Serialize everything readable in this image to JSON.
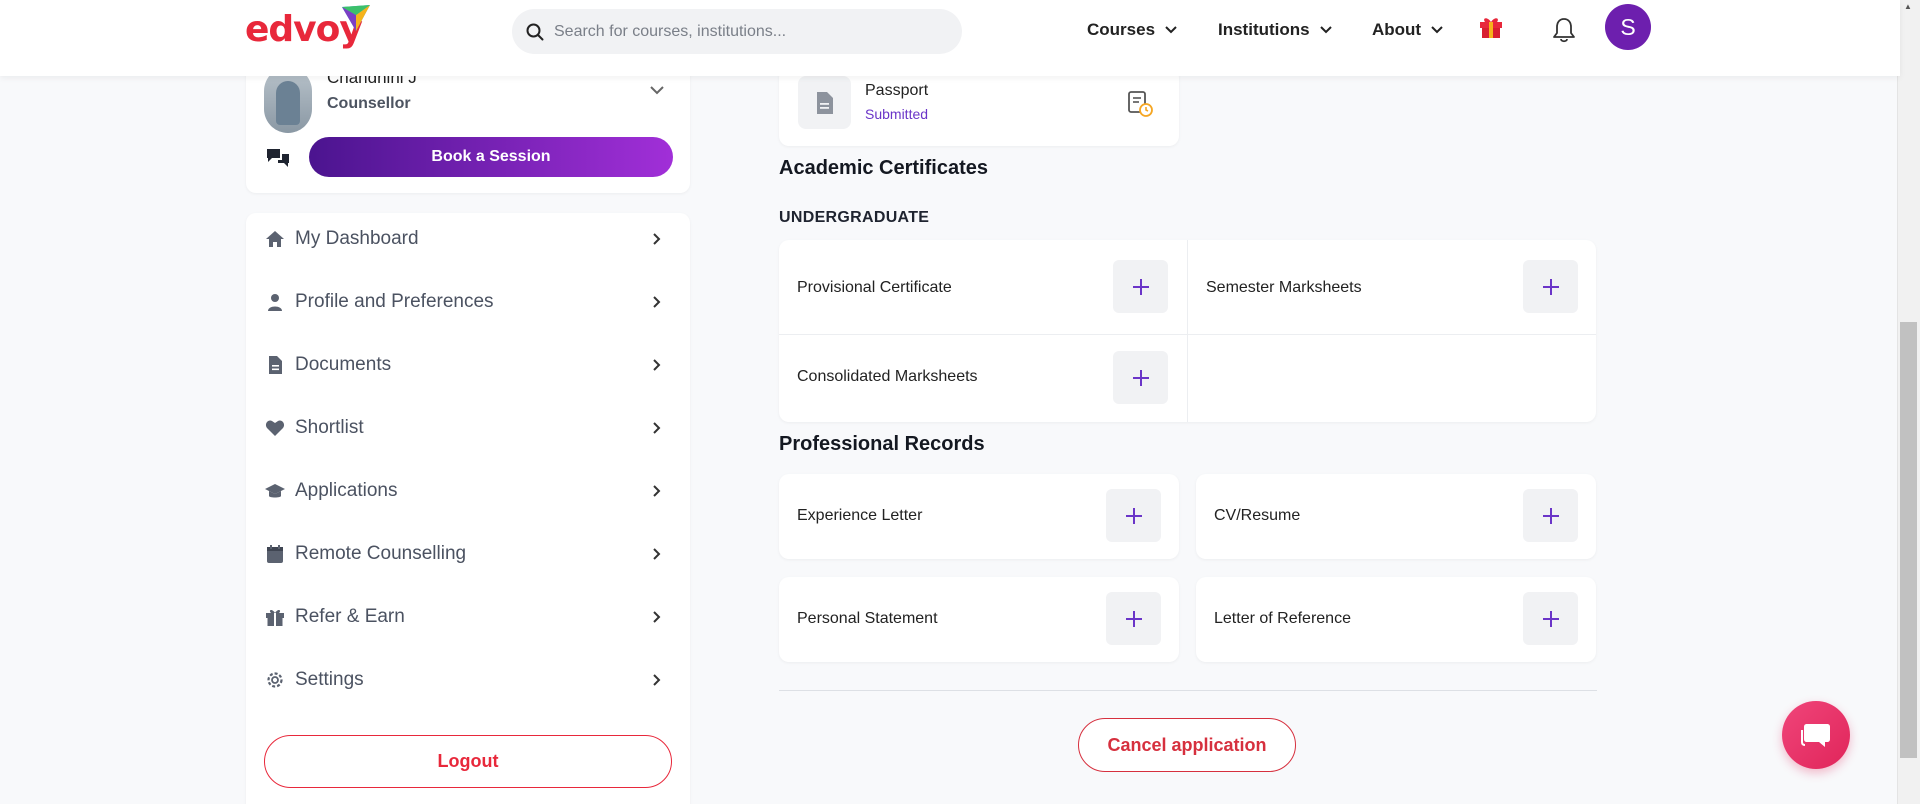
{
  "header": {
    "logo_text": "edvoy",
    "search_placeholder": "Search for courses, institutions...",
    "nav": [
      {
        "label": "Courses"
      },
      {
        "label": "Institutions"
      },
      {
        "label": "About"
      }
    ],
    "avatar_initial": "S",
    "colors": {
      "brand": "#e8283b",
      "avatar": "#6d1fae"
    }
  },
  "counsellor": {
    "name": "Chandhini J",
    "role": "Counsellor",
    "book_label": "Book a Session"
  },
  "sidebar": {
    "items": [
      {
        "label": "My Dashboard",
        "icon": "home-icon"
      },
      {
        "label": "Profile and Preferences",
        "icon": "user-icon"
      },
      {
        "label": "Documents",
        "icon": "document-icon"
      },
      {
        "label": "Shortlist",
        "icon": "heart-icon"
      },
      {
        "label": "Applications",
        "icon": "graduation-cap-icon"
      },
      {
        "label": "Remote Counselling",
        "icon": "calendar-icon"
      },
      {
        "label": "Refer & Earn",
        "icon": "gift-icon"
      },
      {
        "label": "Settings",
        "icon": "gear-icon"
      }
    ],
    "logout_label": "Logout"
  },
  "main": {
    "passport": {
      "title": "Passport",
      "status": "Submitted"
    },
    "academic": {
      "title": "Academic Certificates",
      "subtitle": "UNDERGRADUATE",
      "docs": [
        "Provisional Certificate",
        "Semester Marksheets",
        "Consolidated Marksheets"
      ]
    },
    "professional": {
      "title": "Professional Records",
      "docs": [
        "Experience Letter",
        "CV/Resume",
        "Personal Statement",
        "Letter of Reference"
      ]
    },
    "cancel_label": "Cancel application"
  }
}
